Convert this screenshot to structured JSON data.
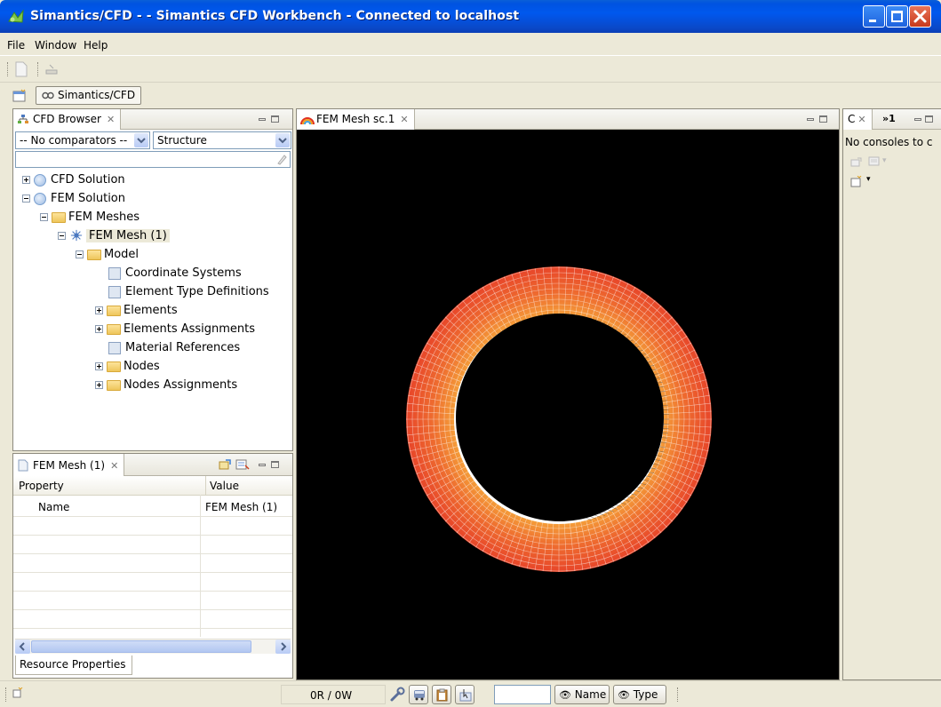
{
  "window": {
    "title": "Simantics/CFD -  - Simantics CFD Workbench - Connected to localhost"
  },
  "menu": {
    "items": [
      {
        "label": "File"
      },
      {
        "label": "Window"
      },
      {
        "label": "Help"
      }
    ]
  },
  "perspective": {
    "tab_label": "Simantics/CFD"
  },
  "cfd_browser": {
    "tab_label": "CFD Browser",
    "comparator_value": "-- No comparators --",
    "structure_value": "Structure",
    "filter_value": "",
    "tree": [
      {
        "label": "CFD Solution"
      },
      {
        "label": "FEM Solution"
      },
      {
        "label": "FEM Meshes"
      },
      {
        "label": "FEM Mesh (1)"
      },
      {
        "label": "Model"
      },
      {
        "label": "Coordinate Systems"
      },
      {
        "label": "Element Type Definitions"
      },
      {
        "label": "Elements"
      },
      {
        "label": "Elements Assignments"
      },
      {
        "label": "Material References"
      },
      {
        "label": "Nodes"
      },
      {
        "label": "Nodes Assignments"
      }
    ]
  },
  "properties": {
    "tab_label": "FEM Mesh (1)",
    "headers": {
      "property": "Property",
      "value": "Value"
    },
    "rows": [
      {
        "property": "Name",
        "value": "FEM Mesh (1)"
      }
    ],
    "bottom_tab": "Resource Properties"
  },
  "editor": {
    "tab_label": "FEM Mesh sc.1"
  },
  "console": {
    "tab_label": "C",
    "overflow_label": "»1",
    "message": "No consoles to c"
  },
  "status": {
    "counter": "0R / 0W",
    "name_button": "Name",
    "type_button": "Type",
    "search_value": ""
  },
  "colors": {
    "titlebar": "#0058ee",
    "mesh_inner": "#f5a13a",
    "mesh_outer": "#e8482a",
    "viewport_bg": "#000000"
  },
  "icons": {
    "app": "cfd-app-icon",
    "new_file": "new-file-icon",
    "open_perspective": "open-perspective-icon",
    "close": "close-icon"
  }
}
